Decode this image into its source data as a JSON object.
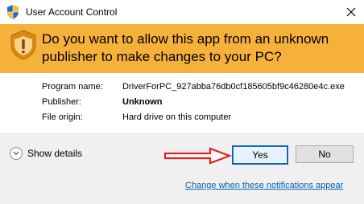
{
  "window": {
    "title": "User Account Control",
    "close_label": "✕"
  },
  "banner": {
    "question": "Do you want to allow this app from an unknown publisher to make changes to your PC?",
    "background": "#f6b13a"
  },
  "details": {
    "program_name_label": "Program name:",
    "program_name_value": "DriverForPC_927abba76db0cf185605bf9c46280e4c.exe",
    "publisher_label": "Publisher:",
    "publisher_value": "Unknown",
    "file_origin_label": "File origin:",
    "file_origin_value": "Hard drive on this computer"
  },
  "footer": {
    "show_details_label": "Show details",
    "yes_label": "Yes",
    "no_label": "No",
    "change_notifications_link": "Change when these notifications appear"
  },
  "annotation": {
    "arrow_color": "#e02020",
    "icon": "red-arrow-right-icon"
  }
}
